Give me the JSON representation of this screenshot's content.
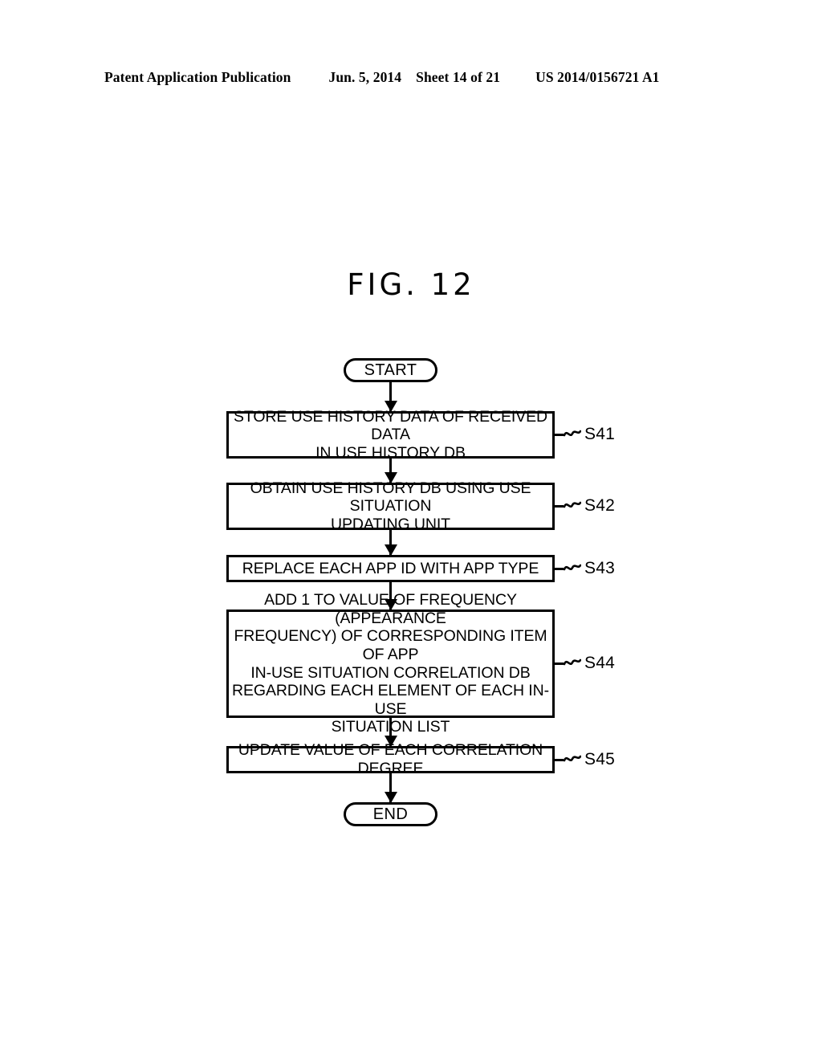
{
  "header": {
    "publication": "Patent Application Publication",
    "date": "Jun. 5, 2014",
    "sheet": "Sheet 14 of 21",
    "patent_number": "US 2014/0156721 A1"
  },
  "figure": {
    "title": "FIG. 12"
  },
  "flowchart": {
    "start_label": "START",
    "end_label": "END",
    "steps": [
      {
        "id": "S41",
        "text": "STORE USE HISTORY DATA OF RECEIVED DATA IN USE HISTORY DB",
        "lines": [
          "STORE USE HISTORY DATA OF RECEIVED DATA",
          "IN USE HISTORY DB"
        ]
      },
      {
        "id": "S42",
        "text": "OBTAIN USE HISTORY DB USING USE SITUATION UPDATING UNIT",
        "lines": [
          "OBTAIN USE HISTORY DB USING USE SITUATION",
          "UPDATING UNIT"
        ]
      },
      {
        "id": "S43",
        "text": "REPLACE EACH APP ID WITH APP TYPE",
        "lines": [
          "REPLACE EACH APP ID WITH APP TYPE"
        ]
      },
      {
        "id": "S44",
        "text": "ADD 1 TO VALUE OF FREQUENCY (APPEARANCE FREQUENCY) OF CORRESPONDING ITEM OF APP IN-USE SITUATION CORRELATION DB REGARDING EACH ELEMENT OF EACH IN-USE SITUATION LIST",
        "lines": [
          "ADD 1 TO VALUE OF FREQUENCY (APPEARANCE",
          "FREQUENCY) OF CORRESPONDING ITEM OF APP",
          "IN-USE SITUATION CORRELATION DB",
          "REGARDING EACH ELEMENT OF EACH IN-USE",
          "SITUATION LIST"
        ]
      },
      {
        "id": "S45",
        "text": "UPDATE VALUE OF EACH CORRELATION DEGREE",
        "lines": [
          "UPDATE VALUE OF EACH CORRELATION DEGREE"
        ]
      }
    ]
  },
  "colors": {
    "ink": "#000000",
    "paper": "#ffffff"
  }
}
